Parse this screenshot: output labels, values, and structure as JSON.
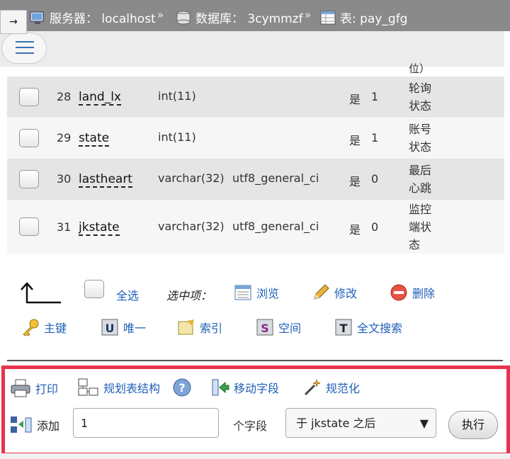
{
  "breadcrumb": {
    "server_label": "服务器： localhost",
    "db_label": "数据库： 3cymmzf",
    "table_label": "表: pay_gfg",
    "separator": "»"
  },
  "nav": {
    "arrow": "→"
  },
  "partial_comment": "位）",
  "rows": [
    {
      "num": "28",
      "name": "land_lx",
      "type": "int(11)",
      "collation": "",
      "null": "是",
      "default": "1",
      "comment": [
        "轮询",
        "状态"
      ]
    },
    {
      "num": "29",
      "name": "state",
      "type": "int(11)",
      "collation": "",
      "null": "是",
      "default": "1",
      "comment": [
        "账号",
        "状态"
      ]
    },
    {
      "num": "30",
      "name": "lastheart",
      "type": "varchar(32)",
      "collation": "utf8_general_ci",
      "null": "是",
      "default": "0",
      "comment": [
        "最后",
        "心跳"
      ]
    },
    {
      "num": "31",
      "name": "jkstate",
      "type": "varchar(32)",
      "collation": "utf8_general_ci",
      "null": "是",
      "default": "0",
      "comment": [
        "监控",
        "端状",
        "态"
      ]
    }
  ],
  "bulk": {
    "select_all": "全选",
    "with_selected": "选中项：",
    "browse": "浏览",
    "change": "修改",
    "drop": "删除",
    "primary": "主键",
    "unique": "唯一",
    "index": "索引",
    "spatial": "空间",
    "fulltext": "全文搜索"
  },
  "tools": {
    "print": "打印",
    "propose": "规划表结构",
    "move": "移动字段",
    "normalize": "规范化"
  },
  "add": {
    "label": "添加",
    "count_value": "1",
    "unit": "个字段",
    "position": "于 jkstate 之后",
    "go": "执行"
  },
  "colors": {
    "accent": "#1f5fb8",
    "highlight": "#e8334a"
  }
}
